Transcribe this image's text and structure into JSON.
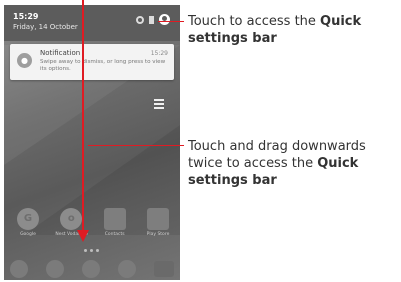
{
  "statusbar": {
    "time": "15:29",
    "date": "Friday, 14 October"
  },
  "notification": {
    "title": "Notification",
    "time": "15:29",
    "body": "Swipe away to dismiss, or long press to view its options."
  },
  "apps": [
    {
      "label": "Google",
      "icon": "G"
    },
    {
      "label": "Nest Vodafone",
      "icon": "o"
    },
    {
      "label": "Contacts",
      "icon": "contacts-icon"
    },
    {
      "label": "Play Store",
      "icon": "play-store-icon"
    }
  ],
  "dock": [
    "phone-icon",
    "messages-icon",
    "apps-drawer-icon",
    "browser-icon",
    "camera-icon"
  ],
  "annotations": {
    "first": {
      "text": "Touch to access the ",
      "bold": "Quick settings bar"
    },
    "second": {
      "text": "Touch and drag downwards twice to access the ",
      "bold": "Quick settings bar"
    }
  },
  "colors": {
    "arrow": "#e01b23",
    "text": "#333333"
  }
}
